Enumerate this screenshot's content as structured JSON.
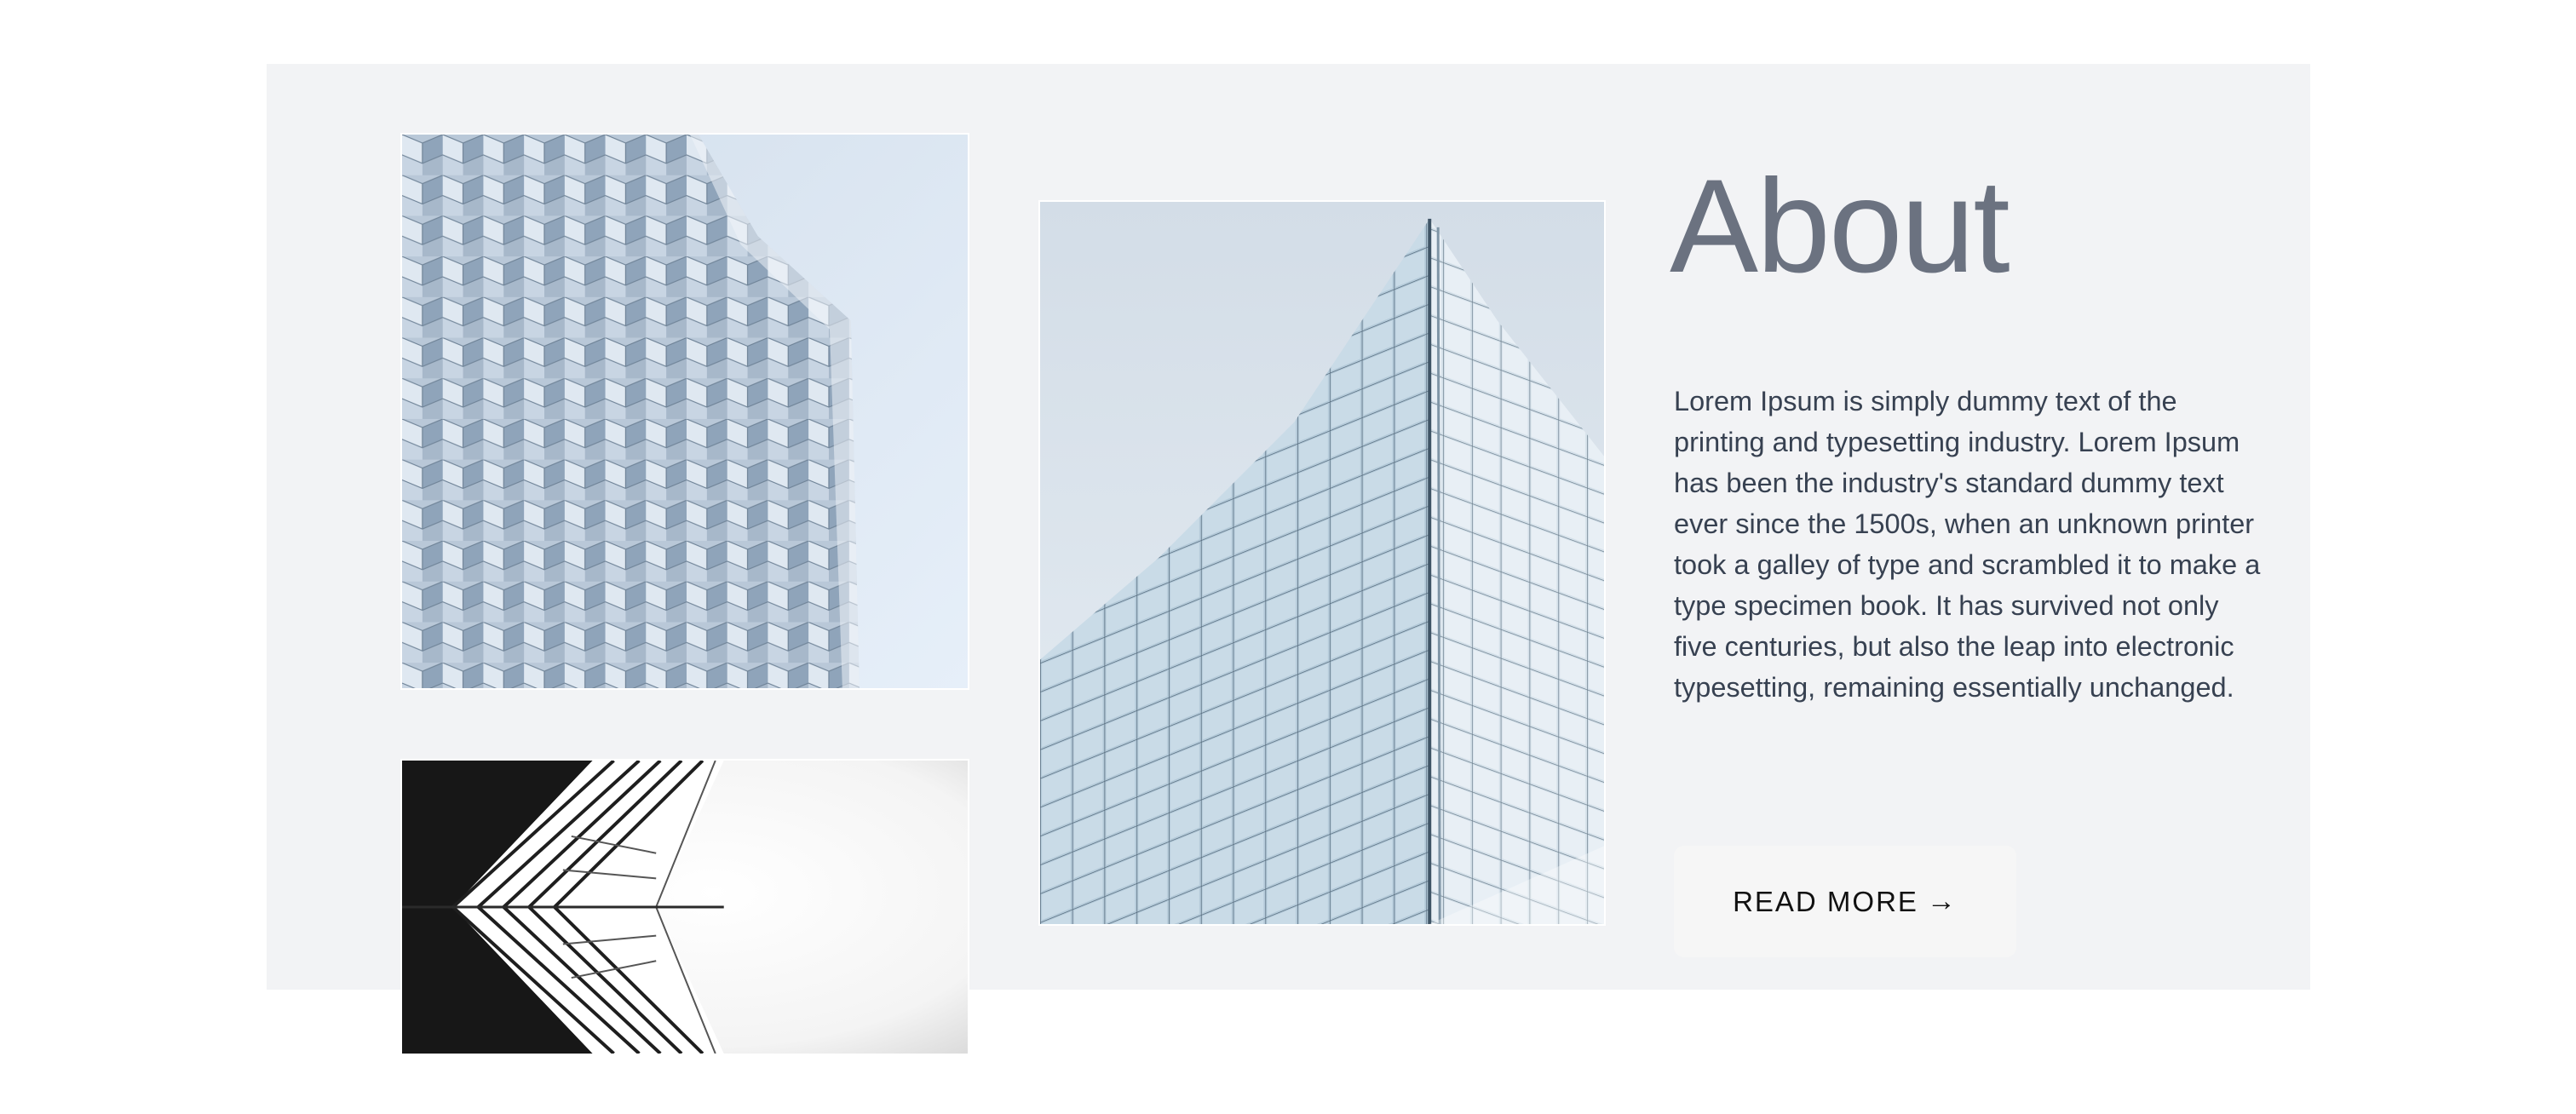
{
  "about": {
    "title": "About",
    "body": "Lorem Ipsum is simply dummy text of the printing and typesetting industry. Lorem Ipsum has been the industry's standard dummy text ever since the 1500s, when an unknown printer took a galley of type and scrambled it to make a type specimen book. It has survived not only five centuries, but also the leap into electronic typesetting, remaining essentially unchanged.",
    "button_label": "READ MORE",
    "button_icon": "arrow-right-icon",
    "button_icon_glyph": "→"
  },
  "colors": {
    "panel_background": "#f2f3f5",
    "title": "#6b7280",
    "body_text": "#374151",
    "button_background": "#f6f6f6"
  }
}
